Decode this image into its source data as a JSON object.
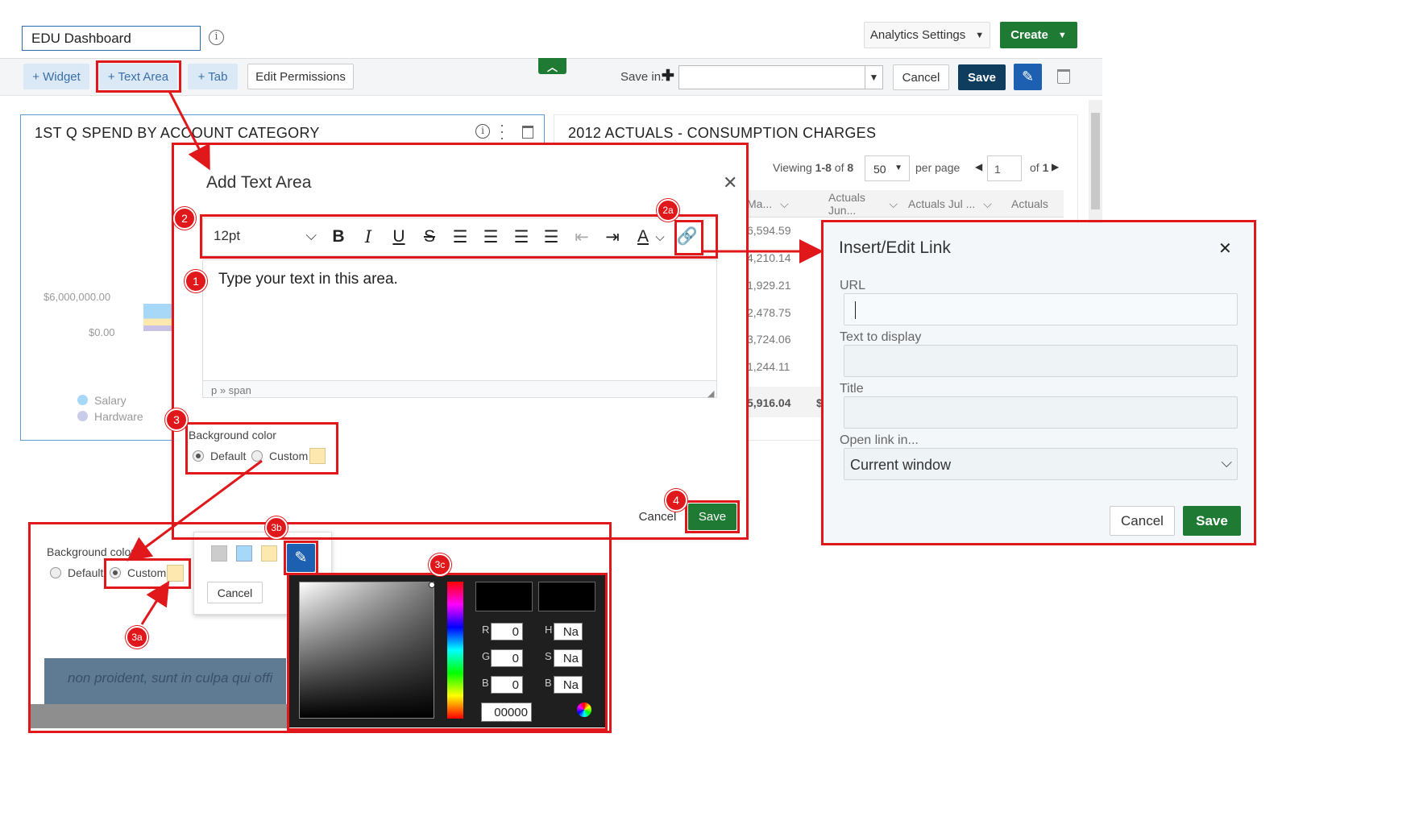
{
  "header": {
    "dashboard_name": "EDU Dashboard",
    "analytics_settings": "Analytics Settings",
    "create": "Create"
  },
  "toolbar": {
    "widget": "+ Widget",
    "text_area": "+ Text Area",
    "tab": "+ Tab",
    "edit_permissions": "Edit Permissions",
    "save_in": "Save in:",
    "cancel": "Cancel",
    "save": "Save"
  },
  "widget1": {
    "title": "1ST Q SPEND BY ACCOUNT CATEGORY",
    "y_labels": [
      "$6,000,000.00",
      "$0.00"
    ],
    "legend": [
      "Salary",
      "Hardware"
    ]
  },
  "widget2": {
    "title": "2012 ACTUALS - CONSUMPTION CHARGES",
    "viewing_prefix": "Viewing",
    "viewing_range": "1-8",
    "viewing_of": "of",
    "viewing_total": "8",
    "per_page_value": "50",
    "per_page": "per page",
    "page": "1",
    "of_pages": "of",
    "total_pages": "1",
    "columns": [
      "Ma...",
      "Actuals Jun...",
      "Actuals Jul ...",
      "Actuals"
    ],
    "values": [
      "6,594.59",
      "4,210.14",
      "1,929.21",
      "2,478.75",
      "3,724.06",
      "1,244.11"
    ],
    "total": "5,916.04",
    "total_next": "$"
  },
  "dialog": {
    "title": "Add Text Area",
    "font_size": "12pt",
    "placeholder_text": "Type your text in this area.",
    "status_path": "p » span",
    "bg_color_label": "Background color",
    "default_label": "Default",
    "custom_label": "Custom",
    "cancel": "Cancel",
    "save": "Save"
  },
  "link_dialog": {
    "title": "Insert/Edit Link",
    "url_label": "URL",
    "text_label": "Text to display",
    "title_label": "Title",
    "open_in_label": "Open link in...",
    "open_in_value": "Current window",
    "cancel": "Cancel",
    "save": "Save"
  },
  "zoom": {
    "bg_color_label": "Background color",
    "default_label": "Default",
    "custom_label": "Custom",
    "cancel": "Cancel",
    "lorem": "non proident, sunt in culpa qui offi"
  },
  "color_picker": {
    "r_label": "R",
    "g_label": "G",
    "b_label": "B",
    "h_label": "H",
    "s_label": "S",
    "b2_label": "B",
    "r": "0",
    "g": "0",
    "b": "0",
    "h": "Na",
    "s": "Na",
    "v": "Na",
    "hex": "00000"
  },
  "callouts": {
    "c1": "1",
    "c2": "2",
    "c2a": "2a",
    "c3": "3",
    "c3a": "3a",
    "c3b": "3b",
    "c3c": "3c",
    "c4": "4"
  },
  "colors": {
    "accent_red": "#e0181b",
    "green": "#1f7a34",
    "navy": "#0e3d5e",
    "swatch_gray": "#cccccc",
    "swatch_blue": "#a8d8f8",
    "swatch_yellow": "#fde9b0"
  }
}
